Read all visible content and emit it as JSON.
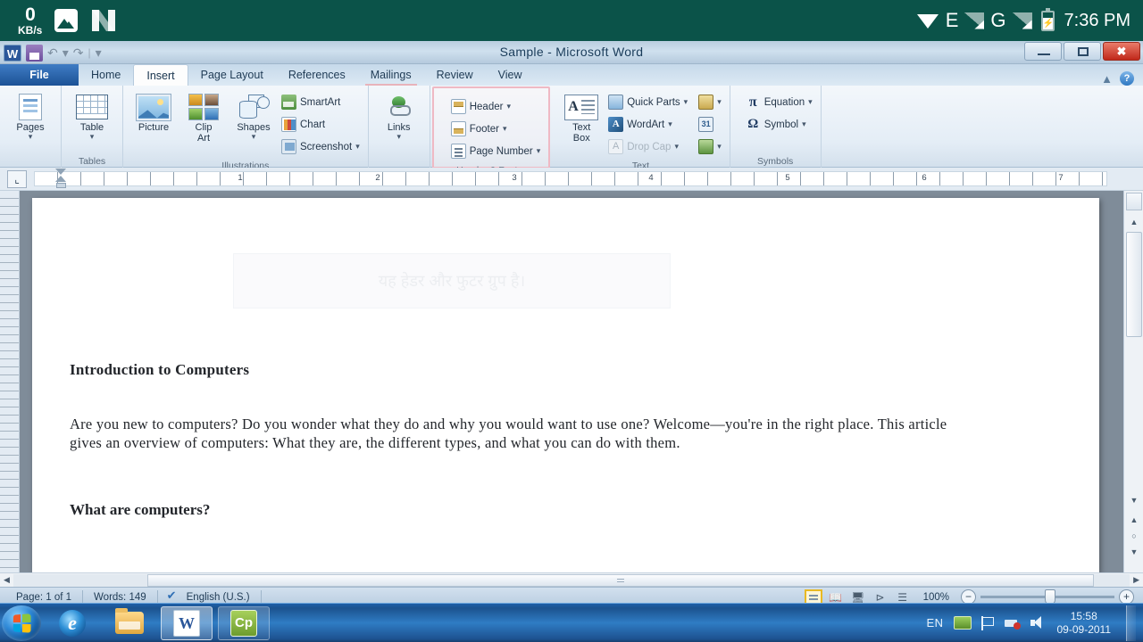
{
  "android_status": {
    "net_speed_value": "0",
    "net_speed_unit": "KB/s",
    "icons": [
      "photo-icon",
      "n-logo-icon"
    ],
    "wifi_icon": "wifi-icon",
    "edge_label": "E",
    "gprs_label": "G",
    "battery_icon": "battery-charging-icon",
    "clock": "7:36 PM",
    "background_color": "#0b5349"
  },
  "window": {
    "title": "Sample - Microsoft Word",
    "quick_access": {
      "app_icon": "W",
      "save_label": "Save",
      "undo_label": "Undo",
      "redo_label": "Redo",
      "customize_label": "Customize Quick Access Toolbar"
    },
    "controls": {
      "minimize": "Minimize",
      "restore": "Restore Down",
      "close": "Close"
    }
  },
  "tabs": [
    {
      "label": "File",
      "type": "file"
    },
    {
      "label": "Home",
      "type": "normal"
    },
    {
      "label": "Insert",
      "type": "active"
    },
    {
      "label": "Page Layout",
      "type": "normal"
    },
    {
      "label": "References",
      "type": "normal"
    },
    {
      "label": "Mailings",
      "type": "underlined"
    },
    {
      "label": "Review",
      "type": "normal"
    },
    {
      "label": "View",
      "type": "normal"
    }
  ],
  "ribbon": {
    "groups": [
      {
        "name": "Pages",
        "label": "",
        "items": [
          {
            "label": "Pages",
            "dropdown": true
          }
        ]
      },
      {
        "name": "Tables",
        "label": "Tables",
        "items": [
          {
            "label": "Table",
            "dropdown": true
          }
        ]
      },
      {
        "name": "Illustrations",
        "label": "Illustrations",
        "items": [
          {
            "label": "Picture"
          },
          {
            "label": "Clip\nArt"
          },
          {
            "label": "Shapes",
            "dropdown": true
          },
          {
            "label": "SmartArt"
          },
          {
            "label": "Chart"
          },
          {
            "label": "Screenshot",
            "dropdown": true
          }
        ]
      },
      {
        "name": "Links",
        "label": "",
        "items": [
          {
            "label": "Links",
            "dropdown": true
          }
        ]
      },
      {
        "name": "HeaderFooter",
        "label": "Header & Footer",
        "highlighted": true,
        "highlight_color": "#efb9c4",
        "items": [
          {
            "label": "Header",
            "dropdown": true
          },
          {
            "label": "Footer",
            "dropdown": true
          },
          {
            "label": "Page Number",
            "dropdown": true
          }
        ]
      },
      {
        "name": "Text",
        "label": "Text",
        "items": [
          {
            "label": "Text\nBox",
            "dropdown": true
          },
          {
            "label": "Quick Parts",
            "dropdown": true
          },
          {
            "label": "WordArt",
            "dropdown": true
          },
          {
            "label": "Drop Cap",
            "dropdown": true,
            "disabled": true
          }
        ]
      },
      {
        "name": "Symbols",
        "label": "Symbols",
        "items": [
          {
            "label": "Equation",
            "glyph": "π",
            "dropdown": true
          },
          {
            "label": "Symbol",
            "glyph": "Ω",
            "dropdown": true
          }
        ]
      }
    ],
    "pages_label": "Pages",
    "table_label": "Table",
    "picture_label": "Picture",
    "clipart_label": "Clip",
    "clipart_label2": "Art",
    "shapes_label": "Shapes",
    "smartart_label": "SmartArt",
    "chart_label": "Chart",
    "screenshot_label": "Screenshot",
    "links_label": "Links",
    "header_label": "Header",
    "footer_label": "Footer",
    "pagenumber_label": "Page Number",
    "textbox_label": "Text",
    "textbox_label2": "Box",
    "quickparts_label": "Quick Parts",
    "wordart_label": "WordArt",
    "dropcap_label": "Drop Cap",
    "equation_label": "Equation",
    "equation_glyph": "π",
    "symbol_label": "Symbol",
    "symbol_glyph": "Ω",
    "group_tables": "Tables",
    "group_illustrations": "Illustrations",
    "group_headerfooter": "Header & Footer",
    "group_text": "Text",
    "group_symbols": "Symbols"
  },
  "ruler": {
    "tab_selector": "⌞",
    "numbers": [
      "1",
      "2",
      "3",
      "4",
      "5",
      "6",
      "7"
    ]
  },
  "document": {
    "header_tooltip": "यह हेडर और फुटर ग्रुप है।",
    "heading1": "Introduction to Computers",
    "paragraph": "Are you new to computers? Do you wonder what they do and why you would want to use one? Welcome—you're in the right place. This article gives an overview of computers: What they are, the different types, and what you can do with them.",
    "heading2": "What are computers?"
  },
  "status_bar": {
    "page": "Page: 1 of 1",
    "words": "Words: 149",
    "proofing_icon": "proofing-check-icon",
    "language": "English (U.S.)",
    "views": [
      "print-layout-view",
      "full-screen-reading-view",
      "web-layout-view",
      "outline-view",
      "draft-view"
    ],
    "zoom": "100%",
    "zoom_out": "−",
    "zoom_in": "+"
  },
  "taskbar": {
    "start_label": "Start",
    "items": [
      {
        "name": "internet-explorer",
        "label": "Internet Explorer"
      },
      {
        "name": "windows-explorer",
        "label": "Windows Explorer"
      },
      {
        "name": "microsoft-word",
        "label": "W",
        "active": true
      },
      {
        "name": "captivate",
        "label": "Cp",
        "open": true
      }
    ],
    "tray": {
      "language": "EN",
      "icons": [
        "green-tray-icon",
        "action-center-flag-icon",
        "network-icon",
        "volume-icon"
      ],
      "time": "15:58",
      "date": "09-09-2011"
    }
  }
}
